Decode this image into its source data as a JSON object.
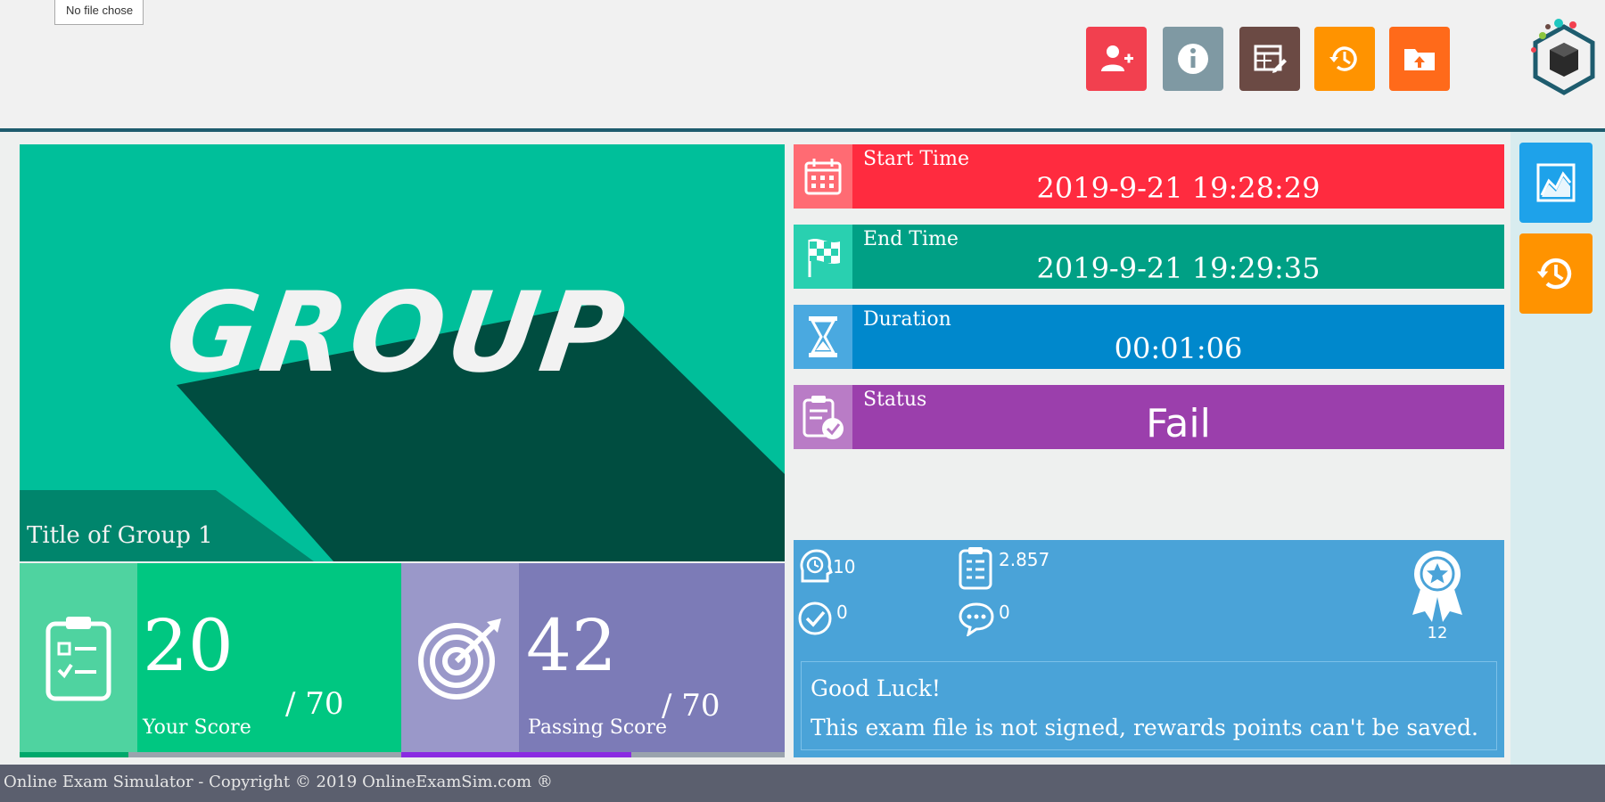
{
  "file_tooltip": "No file chose",
  "toolbar": {
    "buttons": [
      {
        "name": "add-user-button",
        "icon": "add-user-icon",
        "color": "#f2404f"
      },
      {
        "name": "info-button",
        "icon": "info-icon",
        "color": "#7f99a3"
      },
      {
        "name": "edit-table-button",
        "icon": "edit-table-icon",
        "color": "#6b4a44"
      },
      {
        "name": "history-button",
        "icon": "history-icon",
        "color": "#ff9300"
      },
      {
        "name": "upload-folder-button",
        "icon": "upload-folder-icon",
        "color": "#ff6a1a"
      }
    ],
    "logo_icon": "cube-logo-icon"
  },
  "group": {
    "word": "GROUP",
    "title": "Title of Group 1",
    "color": "#00bf9a"
  },
  "score": {
    "your_score": "20",
    "your_score_label": "Your Score",
    "your_score_max": "/ 70",
    "passing_score": "42",
    "passing_score_label": "Passing Score",
    "passing_score_max": "/ 70",
    "your_score_progress": 0.2857,
    "passing_score_progress": 0.6
  },
  "info": {
    "start_label": "Start Time",
    "start_value": "2019-9-21 19:28:29",
    "end_label": "End Time",
    "end_value": "2019-9-21 19:29:35",
    "duration_label": "Duration",
    "duration_value": "00:01:06",
    "status_label": "Status",
    "status_value": "Fail"
  },
  "stats": {
    "head_count": "10",
    "checklist_score": "2.857",
    "correct_count": "0",
    "comments_count": "0",
    "award_count": "12",
    "message_line1": "Good Luck!",
    "message_line2": "This exam file is not signed, rewards points can't be saved."
  },
  "side": {
    "chart_icon": "chart-icon",
    "history_icon": "history-icon"
  },
  "footer": "Online Exam Simulator - Copyright © 2019 OnlineExamSim.com ®"
}
